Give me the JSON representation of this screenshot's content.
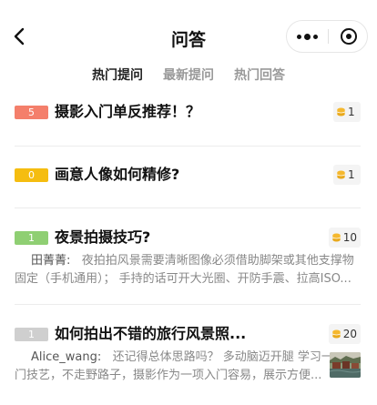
{
  "nav": {
    "title": "问答"
  },
  "tabs": [
    {
      "label": "热门提问",
      "active": true
    },
    {
      "label": "最新提问",
      "active": false
    },
    {
      "label": "热门回答",
      "active": false
    }
  ],
  "questions": [
    {
      "badge": "5",
      "badge_color": "#f47f6b",
      "title": "摄影入门单反推荐！？",
      "reward": "1"
    },
    {
      "badge": "0",
      "badge_color": "#f5bd10",
      "title": "画意人像如何精修?",
      "reward": "1"
    },
    {
      "badge": "1",
      "badge_color": "#8fcf73",
      "title": "夜景拍摄技巧?",
      "reward": "10",
      "answer_author": "田菁菁:",
      "answer_line1": "夜拍拍风景需要清晰图像必须借助脚架或其他支撑物",
      "answer_line2": "固定（手机通用）；  手持的话可开大光圈、开防手震、拉高ISO..."
    },
    {
      "badge": "1",
      "badge_color": "#cfcfcf",
      "title": "如何拍出不错的旅行风景照...",
      "reward": "20",
      "answer_author": "Alice_wang:",
      "answer_line1": "还记得总体思路吗？ 多动脑迈开腿 学习一",
      "answer_line2": "门技艺，不走野路子，摄影作为一项入门容易，展示方便..."
    }
  ],
  "colors": {
    "coin": "#f5b82e",
    "divider": "#ececec"
  }
}
